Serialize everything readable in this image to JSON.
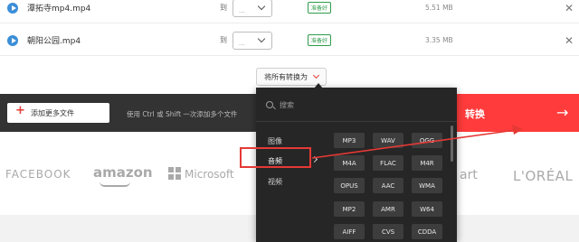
{
  "files": [
    {
      "name": "潭拓寺mp4.mp4",
      "to": "到",
      "format": "...",
      "status": "准备好",
      "size": "5.51 MB"
    },
    {
      "name": "朝阳公园.mp4",
      "to": "到",
      "format": "...",
      "status": "准备好",
      "size": "3.35 MB"
    }
  ],
  "convert_all": {
    "label": "将所有转换为"
  },
  "toolbar": {
    "add_files_label": "添加更多文件",
    "hint": "使用 Ctrl 或 Shift 一次添加多个文件",
    "convert_label": "转换",
    "convert_arrow": "→"
  },
  "dropdown": {
    "search_placeholder": "搜索",
    "categories": [
      "图像",
      "音频",
      "视频"
    ],
    "formats": [
      [
        "MP3",
        "WAV",
        "OGG"
      ],
      [
        "M4A",
        "FLAC",
        "M4R"
      ],
      [
        "OPUS",
        "AAC",
        "WMA"
      ],
      [
        "MP2",
        "AMR",
        "W64"
      ],
      [
        "AIFF",
        "CVS",
        "CDDA"
      ]
    ]
  },
  "logos": {
    "facebook": "FACEBOOK",
    "amazon": "amazon",
    "microsoft": "Microsoft",
    "walmart": "art",
    "loreal": "L'ORÉAL"
  },
  "colors": {
    "accent": "#ff3b3b",
    "dark_bar": "#333333",
    "panel": "#262626",
    "status_green": "#2e9c4a",
    "annotation": "#e53935"
  }
}
